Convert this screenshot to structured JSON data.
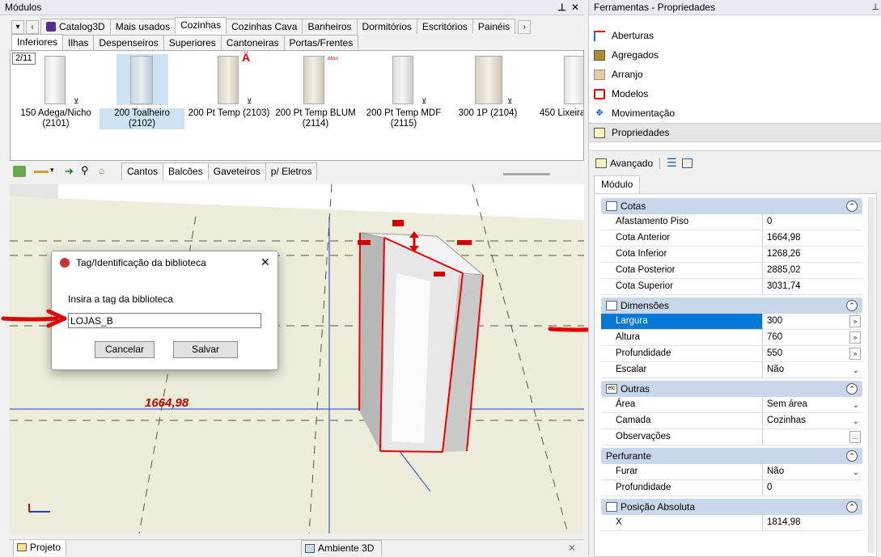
{
  "left_panel": {
    "title": "Módulos",
    "pin": "f",
    "close": "✕"
  },
  "catalog_tabs": [
    "Catalog3D",
    "Mais usados",
    "Cozinhas",
    "Cozinhas Cava",
    "Banheiros",
    "Dormitórios",
    "Escritórios",
    "Painéis"
  ],
  "subtabs": [
    "Inferiores",
    "Ilhas",
    "Despenseiros",
    "Superiores",
    "Cantoneiras",
    "Portas/Frentes"
  ],
  "page_indicator": "2/11",
  "thumbnails": [
    {
      "label": "150 Adega/Nicho (2101)"
    },
    {
      "label": "200 Toalheiro (2102)"
    },
    {
      "label": "200 Pt Temp (2103)"
    },
    {
      "label": "200 Pt Temp BLUM (2114)"
    },
    {
      "label": "200 Pt Temp MDF (2115)"
    },
    {
      "label": "300 1P (2104)"
    },
    {
      "label": "450 Lixeira"
    }
  ],
  "viewport_tabs": [
    "Cantos",
    "Balcões",
    "Gaveteiros",
    "p/ Eletros"
  ],
  "dimension_label": "1664,98",
  "dialog": {
    "title": "Tag/Identificação da biblioteca",
    "prompt": "Insira a tag da biblioteca",
    "input_value": "LOJAS_B",
    "cancel": "Cancelar",
    "save": "Salvar",
    "close": "✕"
  },
  "bottom_tabs": {
    "left": "Projeto",
    "center": "Ambiente 3D",
    "close": "✕"
  },
  "right_panel": {
    "title": "Ferramentas - Propriedades",
    "pin": "f",
    "close": "✕"
  },
  "tools": [
    "Aberturas",
    "Agregados",
    "Arranjo",
    "Modelos",
    "Movimentação",
    "Propriedades"
  ],
  "advanced_label": "Avançado",
  "module_tab": "Módulo",
  "categories": [
    {
      "name": "Cotas",
      "rows": [
        [
          "Afastamento Piso",
          "0"
        ],
        [
          "Cota Anterior",
          "1664,98"
        ],
        [
          "Cota Inferior",
          "1268,26"
        ],
        [
          "Cota Posterior",
          "2885,02"
        ],
        [
          "Cota Superior",
          "3031,74"
        ]
      ]
    },
    {
      "name": "Dimensões",
      "rows": [
        [
          "Largura",
          "300"
        ],
        [
          "Altura",
          "760"
        ],
        [
          "Profundidade",
          "550"
        ],
        [
          "Escalar",
          "Não"
        ]
      ]
    },
    {
      "name": "Outras",
      "rows": [
        [
          "Área",
          "Sem área"
        ],
        [
          "Camada",
          "Cozinhas"
        ],
        [
          "Observações",
          ""
        ]
      ]
    },
    {
      "name": "Perfurante",
      "rows": [
        [
          "Furar",
          "Não"
        ],
        [
          "Profundidade",
          "0"
        ]
      ]
    },
    {
      "name": "Posição Absoluta",
      "rows": [
        [
          "X",
          "1814,98"
        ]
      ]
    }
  ]
}
